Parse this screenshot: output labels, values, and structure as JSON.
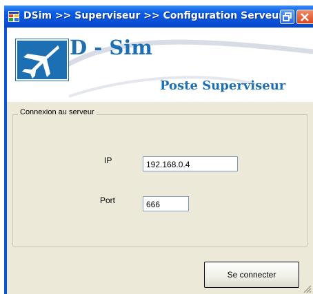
{
  "window": {
    "title": "DSim >> Superviseur >> Configuration Serveur",
    "icon": "app-window-icon",
    "controls": [
      "restore-icon",
      "close-icon"
    ]
  },
  "banner": {
    "brand_name": "D - Sim",
    "subtitle": "Poste Superviseur",
    "logo": "jet-plane-logo",
    "colors": {
      "brand": "#1d6fb4"
    }
  },
  "connection_group": {
    "title": "Connexion au serveur",
    "ip_label": "IP",
    "ip_value": "192.168.0.4",
    "port_label": "Port",
    "port_value": "666"
  },
  "actions": {
    "connect_label": "Se connecter"
  },
  "colors": {
    "titlebar": "#0a56d6",
    "client_background": "#ece9d8",
    "close_button": "#d9491f"
  }
}
